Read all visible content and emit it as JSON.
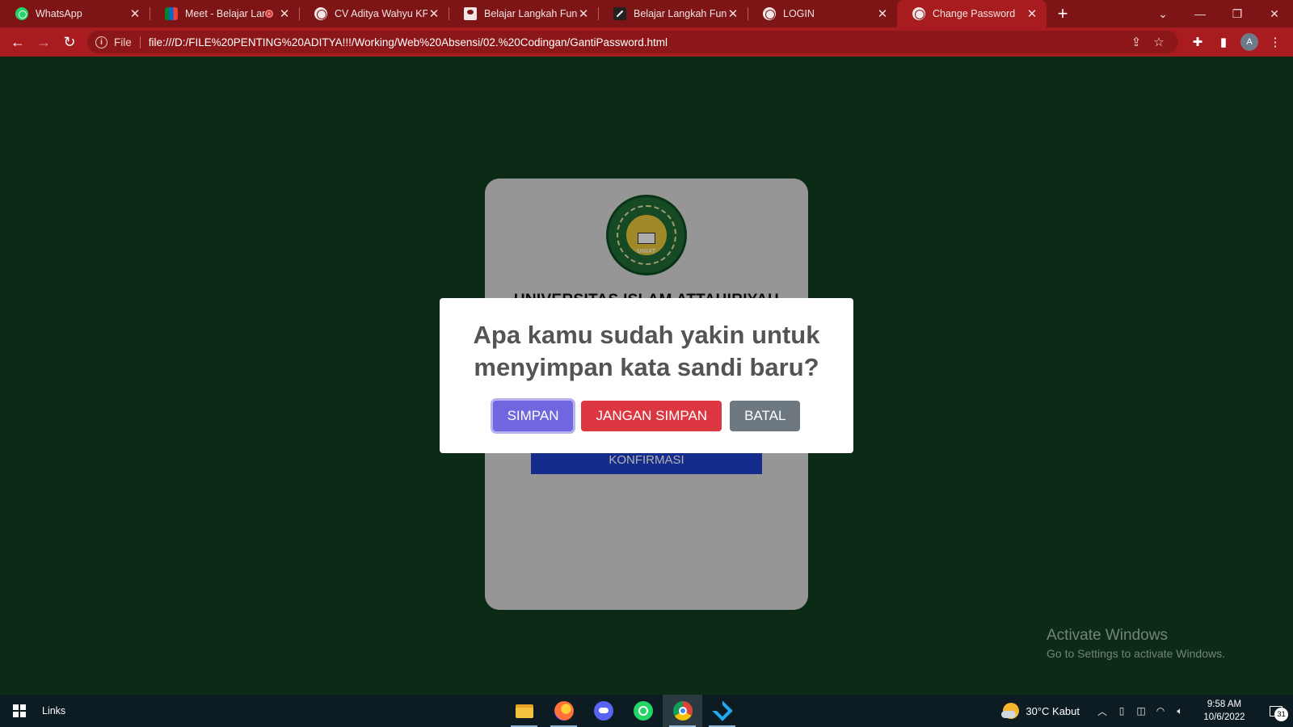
{
  "browser": {
    "tabs": [
      {
        "title": "WhatsApp",
        "icon": "whatsapp-icon",
        "active": false
      },
      {
        "title": "Meet - Belajar Lang",
        "icon": "google-meet-icon",
        "active": false
      },
      {
        "title": "CV Aditya Wahyu KP",
        "icon": "globe-icon",
        "active": false
      },
      {
        "title": "Belajar Langkah Fundan",
        "icon": "document-icon",
        "active": false
      },
      {
        "title": "Belajar Langkah Fundan",
        "icon": "pen-icon",
        "active": false
      },
      {
        "title": "LOGIN",
        "icon": "globe-icon",
        "active": false
      },
      {
        "title": "Change Password",
        "icon": "globe-icon",
        "active": true
      }
    ],
    "scheme_label": "File",
    "url": "file:///D:/FILE%20PENTING%20ADITYA!!!/Working/Web%20Absensi/02.%20Codingan/GantiPassword.html",
    "profile_initial": "A",
    "accent_color": "#a81c1f"
  },
  "page": {
    "university_name": "UNIVERSITAS ISLAM ATTAHIRIYAH",
    "logo_text": "UNIAT",
    "confirm_button": "KONFIRMASI",
    "background_color": "#103e20"
  },
  "dialog": {
    "title": "Apa kamu sudah yakin untuk menyimpan kata sandi baru?",
    "save_label": "SIMPAN",
    "dont_save_label": "JANGAN SIMPAN",
    "cancel_label": "BATAL",
    "colors": {
      "save": "#7066e0",
      "dont_save": "#dc3741",
      "cancel": "#6e7881"
    }
  },
  "watermark": {
    "title": "Activate Windows",
    "subtitle": "Go to Settings to activate Windows."
  },
  "taskbar": {
    "links_label": "Links",
    "apps": [
      "file-explorer-icon",
      "firefox-icon",
      "discord-icon",
      "whatsapp-icon",
      "chrome-icon",
      "vscode-icon"
    ],
    "weather": "30°C  Kabut",
    "time": "9:58 AM",
    "date": "10/6/2022",
    "notification_count": "31"
  }
}
